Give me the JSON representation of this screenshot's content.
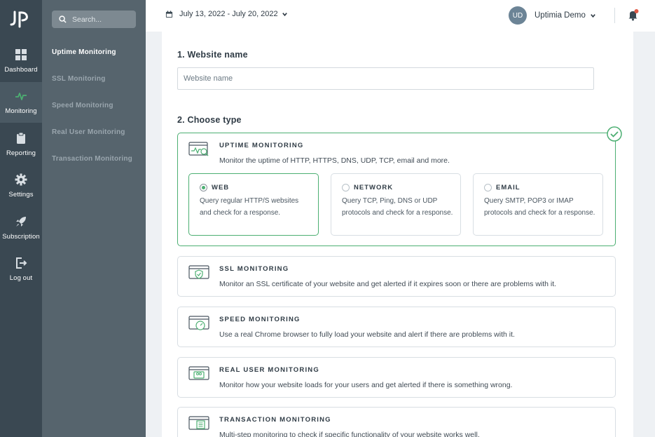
{
  "rail": {
    "logo": "jp-logo",
    "items": [
      {
        "label": "Dashboard",
        "icon": "dashboard-grid-icon"
      },
      {
        "label": "Monitoring",
        "icon": "pulse-icon"
      },
      {
        "label": "Reporting",
        "icon": "clipboard-icon"
      },
      {
        "label": "Settings",
        "icon": "gear-icon"
      },
      {
        "label": "Subscription",
        "icon": "rocket-icon"
      },
      {
        "label": "Log out",
        "icon": "logout-icon"
      }
    ]
  },
  "subnav": {
    "search_placeholder": "Search...",
    "items": [
      {
        "label": "Uptime Monitoring"
      },
      {
        "label": "SSL Monitoring"
      },
      {
        "label": "Speed Monitoring"
      },
      {
        "label": "Real User Monitoring"
      },
      {
        "label": "Transaction Monitoring"
      }
    ]
  },
  "header": {
    "date_range": "July 13, 2022 - July 20, 2022",
    "avatar_initials": "UD",
    "user_name": "Uptimia Demo"
  },
  "form": {
    "section1_title": "1. Website name",
    "name_placeholder": "Website name",
    "section2_title": "2. Choose type",
    "uptime": {
      "title": "UPTIME MONITORING",
      "desc": "Monitor the uptime of HTTP, HTTPS, DNS, UDP, TCP, email and more.",
      "options": [
        {
          "title": "WEB",
          "desc": "Query regular HTTP/S websites and check for a response."
        },
        {
          "title": "NETWORK",
          "desc": "Query TCP, Ping, DNS or UDP protocols and check for a response."
        },
        {
          "title": "EMAIL",
          "desc": "Query SMTP, POP3 or IMAP protocols and check for a response."
        }
      ]
    },
    "types": [
      {
        "title": "SSL MONITORING",
        "desc": "Monitor an SSL certificate of your website and get alerted if it expires soon or there are problems with it."
      },
      {
        "title": "SPEED MONITORING",
        "desc": "Use a real Chrome browser to fully load your website and alert if there are problems with it."
      },
      {
        "title": "REAL USER MONITORING",
        "desc": "Monitor how your website loads for your users and get alerted if there is something wrong."
      },
      {
        "title": "TRANSACTION MONITORING",
        "desc": "Multi-step monitoring to check if specific functionality of your website works well."
      }
    ]
  },
  "colors": {
    "accent": "#4caf72",
    "rail_bg": "#3a4852",
    "subnav_bg": "#56646d",
    "notification_dot": "#e05a47"
  }
}
